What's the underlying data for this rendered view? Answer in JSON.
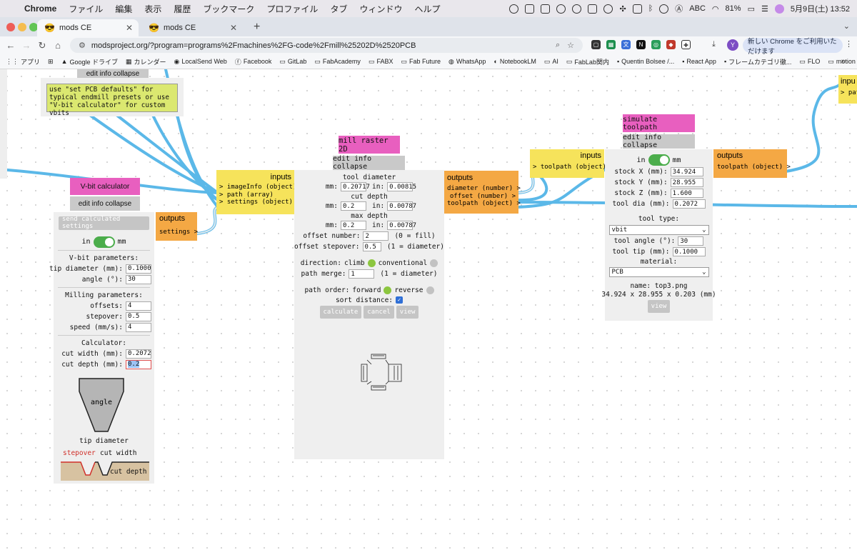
{
  "menubar": {
    "app": "Chrome",
    "items": [
      "ファイル",
      "編集",
      "表示",
      "履歴",
      "ブックマーク",
      "プロファイル",
      "タブ",
      "ウィンドウ",
      "ヘルプ"
    ],
    "input_source": "ABC",
    "battery": "81%",
    "datetime": "5月9日(土) 13:52"
  },
  "tabs": [
    {
      "title": "mods CE",
      "icon": "sunglasses-emoji",
      "active": true
    },
    {
      "title": "mods CE",
      "icon": "sunglasses-emoji",
      "active": false
    }
  ],
  "toolbar": {
    "url": "modsproject.org/?program=programs%2Fmachines%2FG-code%2Fmill%25202D%2520PCB",
    "update_label": "新しい Chrome をご利用いただけます",
    "avatar_initial": "Y"
  },
  "bookmarks": [
    {
      "label": "アプリ",
      "icon": "apps-grid-icon"
    },
    {
      "label": "",
      "icon": "grid-icon"
    },
    {
      "label": "Google ドライブ",
      "icon": "drive-icon"
    },
    {
      "label": "カレンダー",
      "icon": "calendar-icon"
    },
    {
      "label": "LocalSend Web",
      "icon": "localsend-icon"
    },
    {
      "label": "Facebook",
      "icon": "facebook-icon"
    },
    {
      "label": "GitLab",
      "icon": "folder-icon"
    },
    {
      "label": "FabAcademy",
      "icon": "folder-icon"
    },
    {
      "label": "FABX",
      "icon": "folder-icon"
    },
    {
      "label": "Fab Future",
      "icon": "folder-icon"
    },
    {
      "label": "WhatsApp",
      "icon": "whatsapp-icon"
    },
    {
      "label": "NotebookLM",
      "icon": "notebooklm-icon"
    },
    {
      "label": "AI",
      "icon": "folder-icon"
    },
    {
      "label": "FabLab関内",
      "icon": "folder-icon"
    },
    {
      "label": "Quentin Bolsee /...",
      "icon": "site-icon"
    },
    {
      "label": "React App",
      "icon": "site-icon"
    },
    {
      "label": "フレームカテゴリ徹...",
      "icon": "site-icon"
    },
    {
      "label": "FLO",
      "icon": "folder-icon"
    },
    {
      "label": "motion",
      "icon": "folder-icon"
    }
  ],
  "note_module": {
    "menu": "edit info collapse",
    "note": "use \"set PCB defaults\" for typical endmill presets or use \"V-bit calculator\" for custom vbits"
  },
  "vbit": {
    "title": "V-bit calculator",
    "menu": "edit info collapse",
    "send_button": "send calculated settings",
    "unit_in": "in",
    "unit_mm": "mm",
    "params_header": "V-bit parameters:",
    "tip_label": "tip diameter (mm):",
    "tip_value": "0.1000",
    "angle_label": "angle (°):",
    "angle_value": "30",
    "milling_header": "Milling parameters:",
    "offsets_label": "offsets:",
    "offsets_value": "4",
    "stepover_label": "stepover:",
    "stepover_value": "0.5",
    "speed_label": "speed (mm/s):",
    "speed_value": "4",
    "calc_header": "Calculator:",
    "cutwidth_label": "cut width (mm):",
    "cutwidth_value": "0.2072",
    "cutdepth_label": "cut depth (mm):",
    "cutdepth_value": "0.2",
    "diagram_angle": "angle",
    "diagram_tip": "tip diameter",
    "diagram_stepover": "stepover",
    "diagram_cutwidth": "cut width",
    "diagram_cutdepth": "cut depth",
    "outputs_label": "outputs",
    "output_settings": "settings >"
  },
  "mill": {
    "title": "mill raster 2D",
    "menu": "edit info collapse",
    "inputs_label": "inputs",
    "input_ports": [
      "> imageInfo (object)",
      "> path (array)",
      "> settings (object)"
    ],
    "tool_diameter_label": "tool diameter",
    "tool_diameter_mm": "0.20717",
    "tool_diameter_in": "0.00815",
    "cut_depth_label": "cut depth",
    "cut_depth_mm": "0.2",
    "cut_depth_in": "0.00787",
    "max_depth_label": "max depth",
    "max_depth_mm": "0.2",
    "max_depth_in": "0.00787",
    "mm_label": "mm:",
    "in_label": "in:",
    "offset_number_label": "offset number:",
    "offset_number_value": "2",
    "offset_number_hint": "(0 = fill)",
    "offset_stepover_label": "offset stepover:",
    "offset_stepover_value": "0.5",
    "offset_stepover_hint": "(1 = diameter)",
    "direction_label": "direction:",
    "climb_label": "climb",
    "conventional_label": "conventional",
    "path_merge_label": "path merge:",
    "path_merge_value": "1",
    "path_merge_hint": "(1 = diameter)",
    "path_order_label": "path order:",
    "forward_label": "forward",
    "reverse_label": "reverse",
    "sort_distance_label": "sort distance:",
    "calculate_button": "calculate",
    "cancel_button": "cancel",
    "view_button": "view",
    "outputs_label": "outputs",
    "output_ports": [
      "diameter (number) >",
      "offset (number) >",
      "toolpath (object) >"
    ]
  },
  "sim": {
    "title": "simulate toolpath",
    "menu": "edit info collapse",
    "inputs_label": "inputs",
    "input_port": "> toolpath (object)",
    "unit_in": "in",
    "unit_mm": "mm",
    "stock_x_label": "stock X (mm):",
    "stock_x_value": "34.924",
    "stock_y_label": "stock Y (mm):",
    "stock_y_value": "28.955",
    "stock_z_label": "stock Z (mm):",
    "stock_z_value": "1.600",
    "tool_dia_label": "tool dia (mm):",
    "tool_dia_value": "0.2072",
    "tool_type_label": "tool type:",
    "tool_type_value": "vbit",
    "tool_angle_label": "tool angle (°):",
    "tool_angle_value": "30",
    "tool_tip_label": "tool tip (mm):",
    "tool_tip_value": "0.1000",
    "material_label": "material:",
    "material_value": "PCB",
    "name_line": "name: top3.png",
    "size_line": "34.924 x 28.955 x 0.203 (mm)",
    "view_button": "view",
    "outputs_label": "outputs",
    "output_port": "toolpath (object) >"
  },
  "right_module": {
    "inputs_label": "inpu",
    "input_port": "> pat"
  },
  "colors": {
    "wire": "#5bb8e8",
    "title_pink": "#e85fbf",
    "inputs_yellow": "#f6e35b",
    "outputs_orange": "#f4a844",
    "note_green": "#dbe870",
    "toggle_green": "#4bad4b"
  }
}
